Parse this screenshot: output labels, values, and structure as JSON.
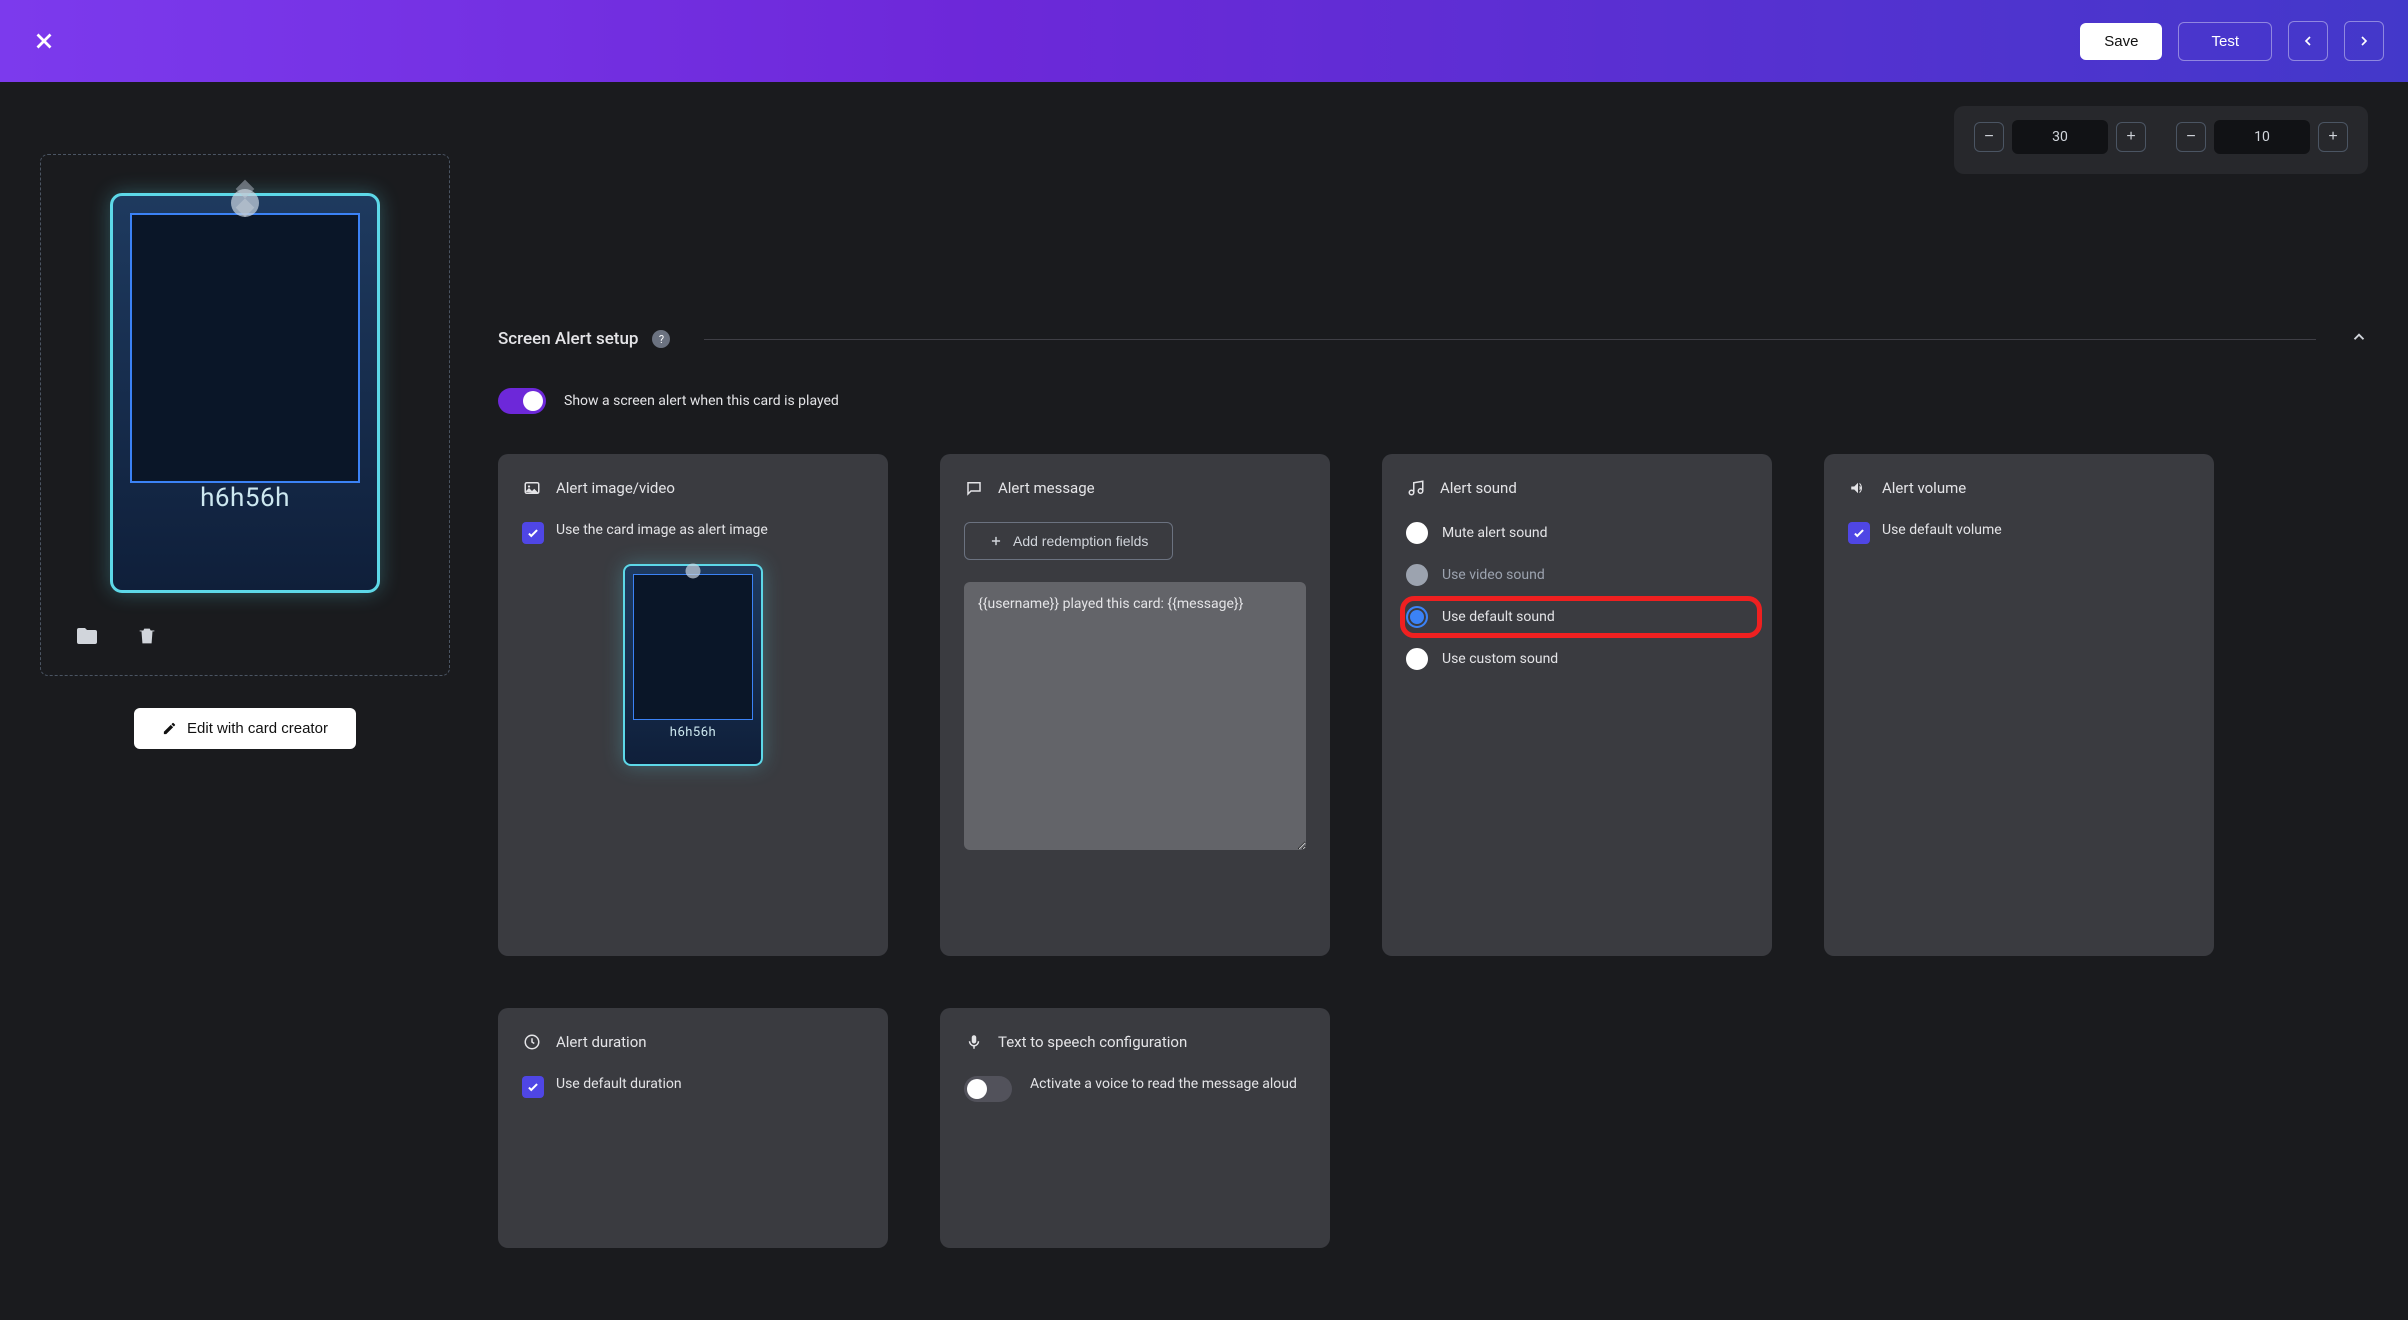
{
  "topbar": {
    "save": "Save",
    "test": "Test"
  },
  "steppers": {
    "left_value": "30",
    "right_value": "10"
  },
  "card": {
    "name": "h6h56h",
    "edit_button": "Edit with card creator"
  },
  "section": {
    "title": "Screen Alert setup",
    "toggle_label": "Show a screen alert when this card is played"
  },
  "panels": {
    "image": {
      "title": "Alert image/video",
      "checkbox_label": "Use the card image as alert image",
      "small_card_name": "h6h56h"
    },
    "message": {
      "title": "Alert message",
      "add_fields": "Add redemption fields",
      "textarea_value": "{{username}} played this card: {{message}}"
    },
    "sound": {
      "title": "Alert sound",
      "options": {
        "mute": "Mute alert sound",
        "video": "Use video sound",
        "default": "Use default sound",
        "custom": "Use custom sound"
      }
    },
    "volume": {
      "title": "Alert volume",
      "checkbox_label": "Use default volume"
    },
    "duration": {
      "title": "Alert duration",
      "checkbox_label": "Use default duration"
    },
    "tts": {
      "title": "Text to speech configuration",
      "toggle_label": "Activate a voice to read the message aloud"
    }
  }
}
